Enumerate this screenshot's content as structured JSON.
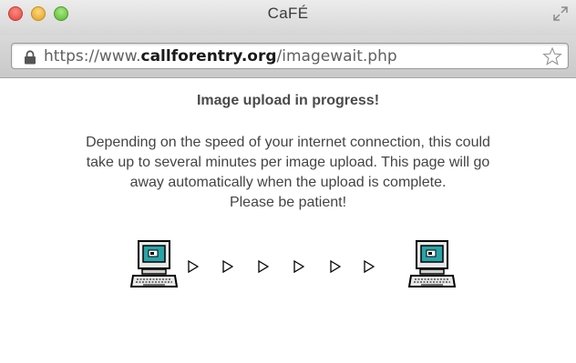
{
  "window": {
    "title": "CaFÉ"
  },
  "address_bar": {
    "url_prefix": "https://www.",
    "url_domain": "callforentry.org",
    "url_path": "/imagewait.php"
  },
  "page": {
    "heading": "Image upload in progress!",
    "message_lines": [
      "Depending on the speed of your internet connection, this could",
      "take up to several minutes per image upload. This page will go",
      "away automatically when the upload is complete.",
      "Please be patient!"
    ]
  },
  "icons": {
    "traffic_lights": [
      "close-icon",
      "minimize-icon",
      "maximize-icon"
    ],
    "address_bar": [
      "lock-icon",
      "bookmark-star-icon"
    ],
    "transfer": [
      "source-computer-icon",
      "arrow-icon",
      "destination-computer-icon"
    ]
  },
  "colors": {
    "traffic_close": "#e0443e",
    "traffic_minimize": "#dea123",
    "traffic_maximize": "#58b32f",
    "screen_teal": "#2aa3a8"
  }
}
